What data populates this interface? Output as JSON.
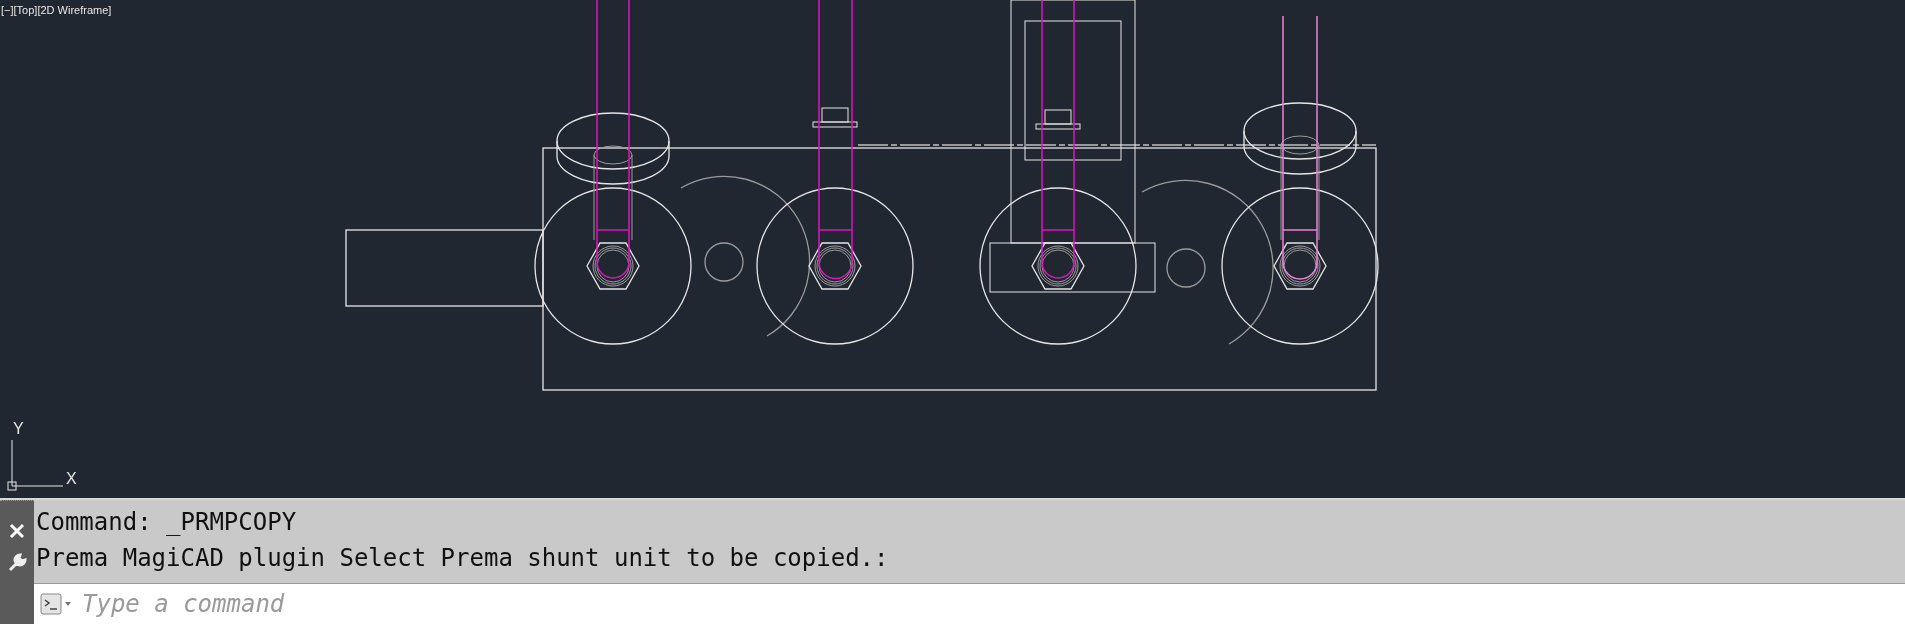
{
  "viewport": {
    "label": "[−][Top][2D Wireframe]",
    "axis_labels": [
      "Y",
      "X"
    ]
  },
  "command_line": {
    "history": [
      "Command: _PRMPCOPY",
      "Prema MagiCAD plugin Select Prema shunt unit to be copied.:"
    ],
    "placeholder": "Type a command"
  }
}
